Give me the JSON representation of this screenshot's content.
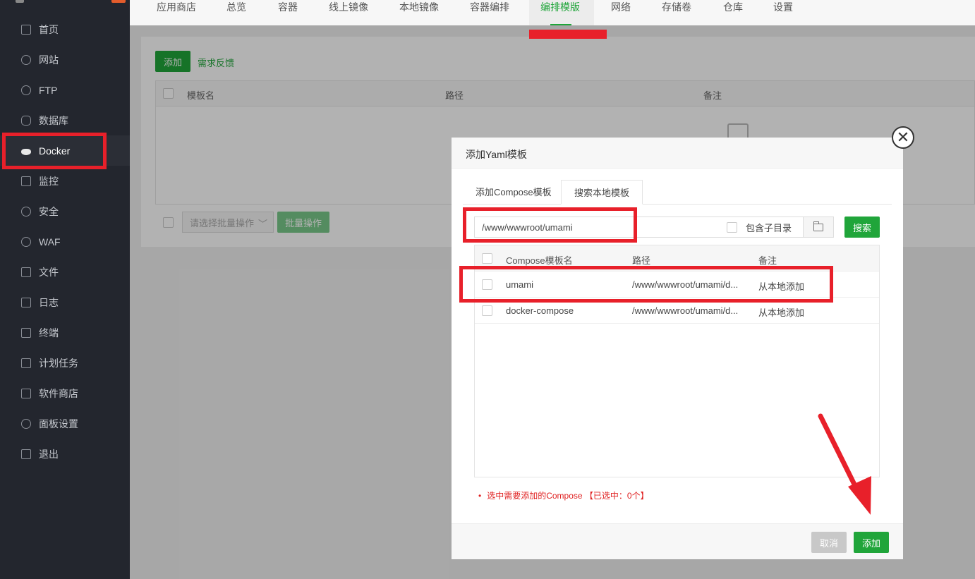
{
  "sidebar": {
    "items": [
      {
        "label": "首页",
        "icon": "home-icon"
      },
      {
        "label": "网站",
        "icon": "globe-icon"
      },
      {
        "label": "FTP",
        "icon": "ftp-globe-icon"
      },
      {
        "label": "数据库",
        "icon": "database-icon"
      },
      {
        "label": "Docker",
        "icon": "docker-whale-icon"
      },
      {
        "label": "监控",
        "icon": "monitor-icon"
      },
      {
        "label": "安全",
        "icon": "shield-icon"
      },
      {
        "label": "WAF",
        "icon": "waf-shield-icon"
      },
      {
        "label": "文件",
        "icon": "folder-icon"
      },
      {
        "label": "日志",
        "icon": "log-icon"
      },
      {
        "label": "终端",
        "icon": "terminal-icon"
      },
      {
        "label": "计划任务",
        "icon": "calendar-icon"
      },
      {
        "label": "软件商店",
        "icon": "apps-grid-icon"
      },
      {
        "label": "面板设置",
        "icon": "gear-icon"
      },
      {
        "label": "退出",
        "icon": "logout-icon"
      }
    ],
    "active": "Docker"
  },
  "tabs": [
    "应用商店",
    "总览",
    "容器",
    "线上镜像",
    "本地镜像",
    "容器编排",
    "编排模版",
    "网络",
    "存储卷",
    "仓库",
    "设置"
  ],
  "active_tab": "编排模版",
  "main": {
    "add_button": "添加",
    "feedback_link": "需求反馈",
    "columns": [
      "模板名",
      "路径",
      "备注"
    ],
    "batch_select_placeholder": "请选择批量操作",
    "batch_button": "批量操作"
  },
  "modal": {
    "title": "添加Yaml模板",
    "tabs": [
      "添加Compose模板",
      "搜索本地模板"
    ],
    "active_tab": "搜索本地模板",
    "path_value": "/www/wwwroot/umami",
    "include_subdir_label": "包含子目录",
    "search_button": "搜索",
    "columns": [
      "Compose模板名",
      "路径",
      "备注"
    ],
    "rows": [
      {
        "name": "umami",
        "path": "/www/wwwroot/umami/d...",
        "note": "从本地添加"
      },
      {
        "name": "docker-compose",
        "path": "/www/wwwroot/umami/d...",
        "note": "从本地添加"
      }
    ],
    "hint": "选中需要添加的Compose 【已选中：0个】",
    "cancel_button": "取消",
    "confirm_button": "添加"
  },
  "colors": {
    "accent": "#20a53a",
    "annotation": "#e8202a",
    "sidebar_bg": "#23262e"
  }
}
